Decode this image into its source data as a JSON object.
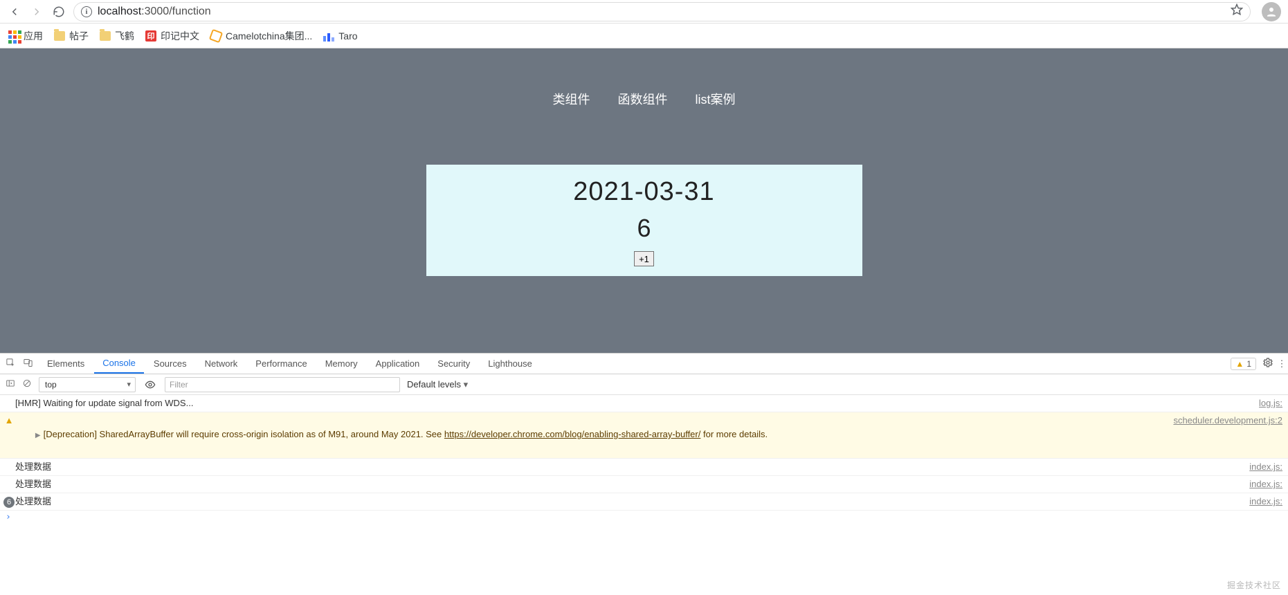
{
  "browser": {
    "url_host": "localhost",
    "url_port_path": ":3000/function",
    "bookmarks": {
      "apps_label": "应用",
      "items": [
        {
          "label": "帖子",
          "icon": "folder"
        },
        {
          "label": "飞鹤",
          "icon": "folder"
        },
        {
          "label": "印记中文",
          "icon": "yinji"
        },
        {
          "label": "Camelotchina集团...",
          "icon": "camelot"
        },
        {
          "label": "Taro",
          "icon": "taro"
        }
      ]
    }
  },
  "page": {
    "nav": [
      "类组件",
      "函数组件",
      "list案例"
    ],
    "date": "2021-03-31",
    "count": "6",
    "button_label": "+1"
  },
  "devtools": {
    "tabs": [
      "Elements",
      "Console",
      "Sources",
      "Network",
      "Performance",
      "Memory",
      "Application",
      "Security",
      "Lighthouse"
    ],
    "active_tab": "Console",
    "warning_count": "1",
    "context": "top",
    "filter_placeholder": "Filter",
    "levels_label": "Default levels",
    "logs": [
      {
        "type": "log",
        "gutter": "",
        "text": "[HMR] Waiting for update signal from WDS...",
        "src": "log.js:"
      },
      {
        "type": "warn",
        "gutter": "▶",
        "text_before": "[Deprecation] SharedArrayBuffer will require cross-origin isolation as of M91, around May 2021. See ",
        "link": "https://developer.chrome.com/blog/enabling-shared-array-buffer/",
        "text_after": " for more details.",
        "src": "scheduler.development.js:2"
      },
      {
        "type": "log",
        "gutter": "",
        "text": "处理数据",
        "src": "index.js:"
      },
      {
        "type": "log",
        "gutter": "",
        "text": "处理数据",
        "src": "index.js:"
      },
      {
        "type": "log",
        "gutter": "badge:6",
        "text": "处理数据",
        "src": "index.js:"
      }
    ],
    "prompt": "›"
  },
  "watermark": "掘金技术社区"
}
